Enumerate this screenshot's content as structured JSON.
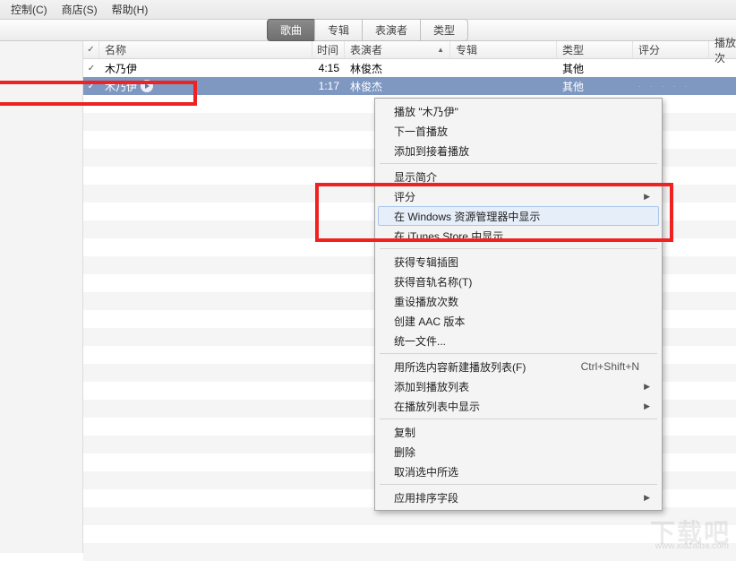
{
  "menubar": {
    "control": "控制(C)",
    "store": "商店(S)",
    "help": "帮助(H)"
  },
  "tabs": {
    "songs": "歌曲",
    "albums": "专辑",
    "artists": "表演者",
    "genres": "类型"
  },
  "columns": {
    "name": "名称",
    "time": "时间",
    "artist": "表演者",
    "album": "专辑",
    "genre": "类型",
    "rating": "评分",
    "plays": "播放次"
  },
  "tracks": [
    {
      "name": "木乃伊",
      "time": "4:15",
      "artist": "林俊杰",
      "genre": "其他"
    },
    {
      "name": "木乃伊",
      "time": "1:17",
      "artist": "林俊杰",
      "genre": "其他"
    }
  ],
  "context_menu": {
    "play_track": "播放 \"木乃伊\"",
    "play_next": "下一首播放",
    "add_up_next": "添加到接着播放",
    "get_info": "显示简介",
    "rating": "评分",
    "show_explorer": "在 Windows 资源管理器中显示",
    "show_store": "在 iTunes Store 中显示",
    "get_artwork": "获得专辑插图",
    "get_track_names": "获得音轨名称(T)",
    "reset_plays": "重设播放次数",
    "create_aac": "创建 AAC 版本",
    "consolidate": "统一文件...",
    "new_playlist": "用所选内容新建播放列表(F)",
    "new_playlist_sc": "Ctrl+Shift+N",
    "add_playlist": "添加到播放列表",
    "show_playlist": "在播放列表中显示",
    "copy": "复制",
    "delete": "删除",
    "uncheck": "取消选中所选",
    "sort_fields": "应用排序字段"
  },
  "rating_dots": "· · · · ·",
  "watermark": "下载吧",
  "watermark_url": "www.xiazaiba.com"
}
